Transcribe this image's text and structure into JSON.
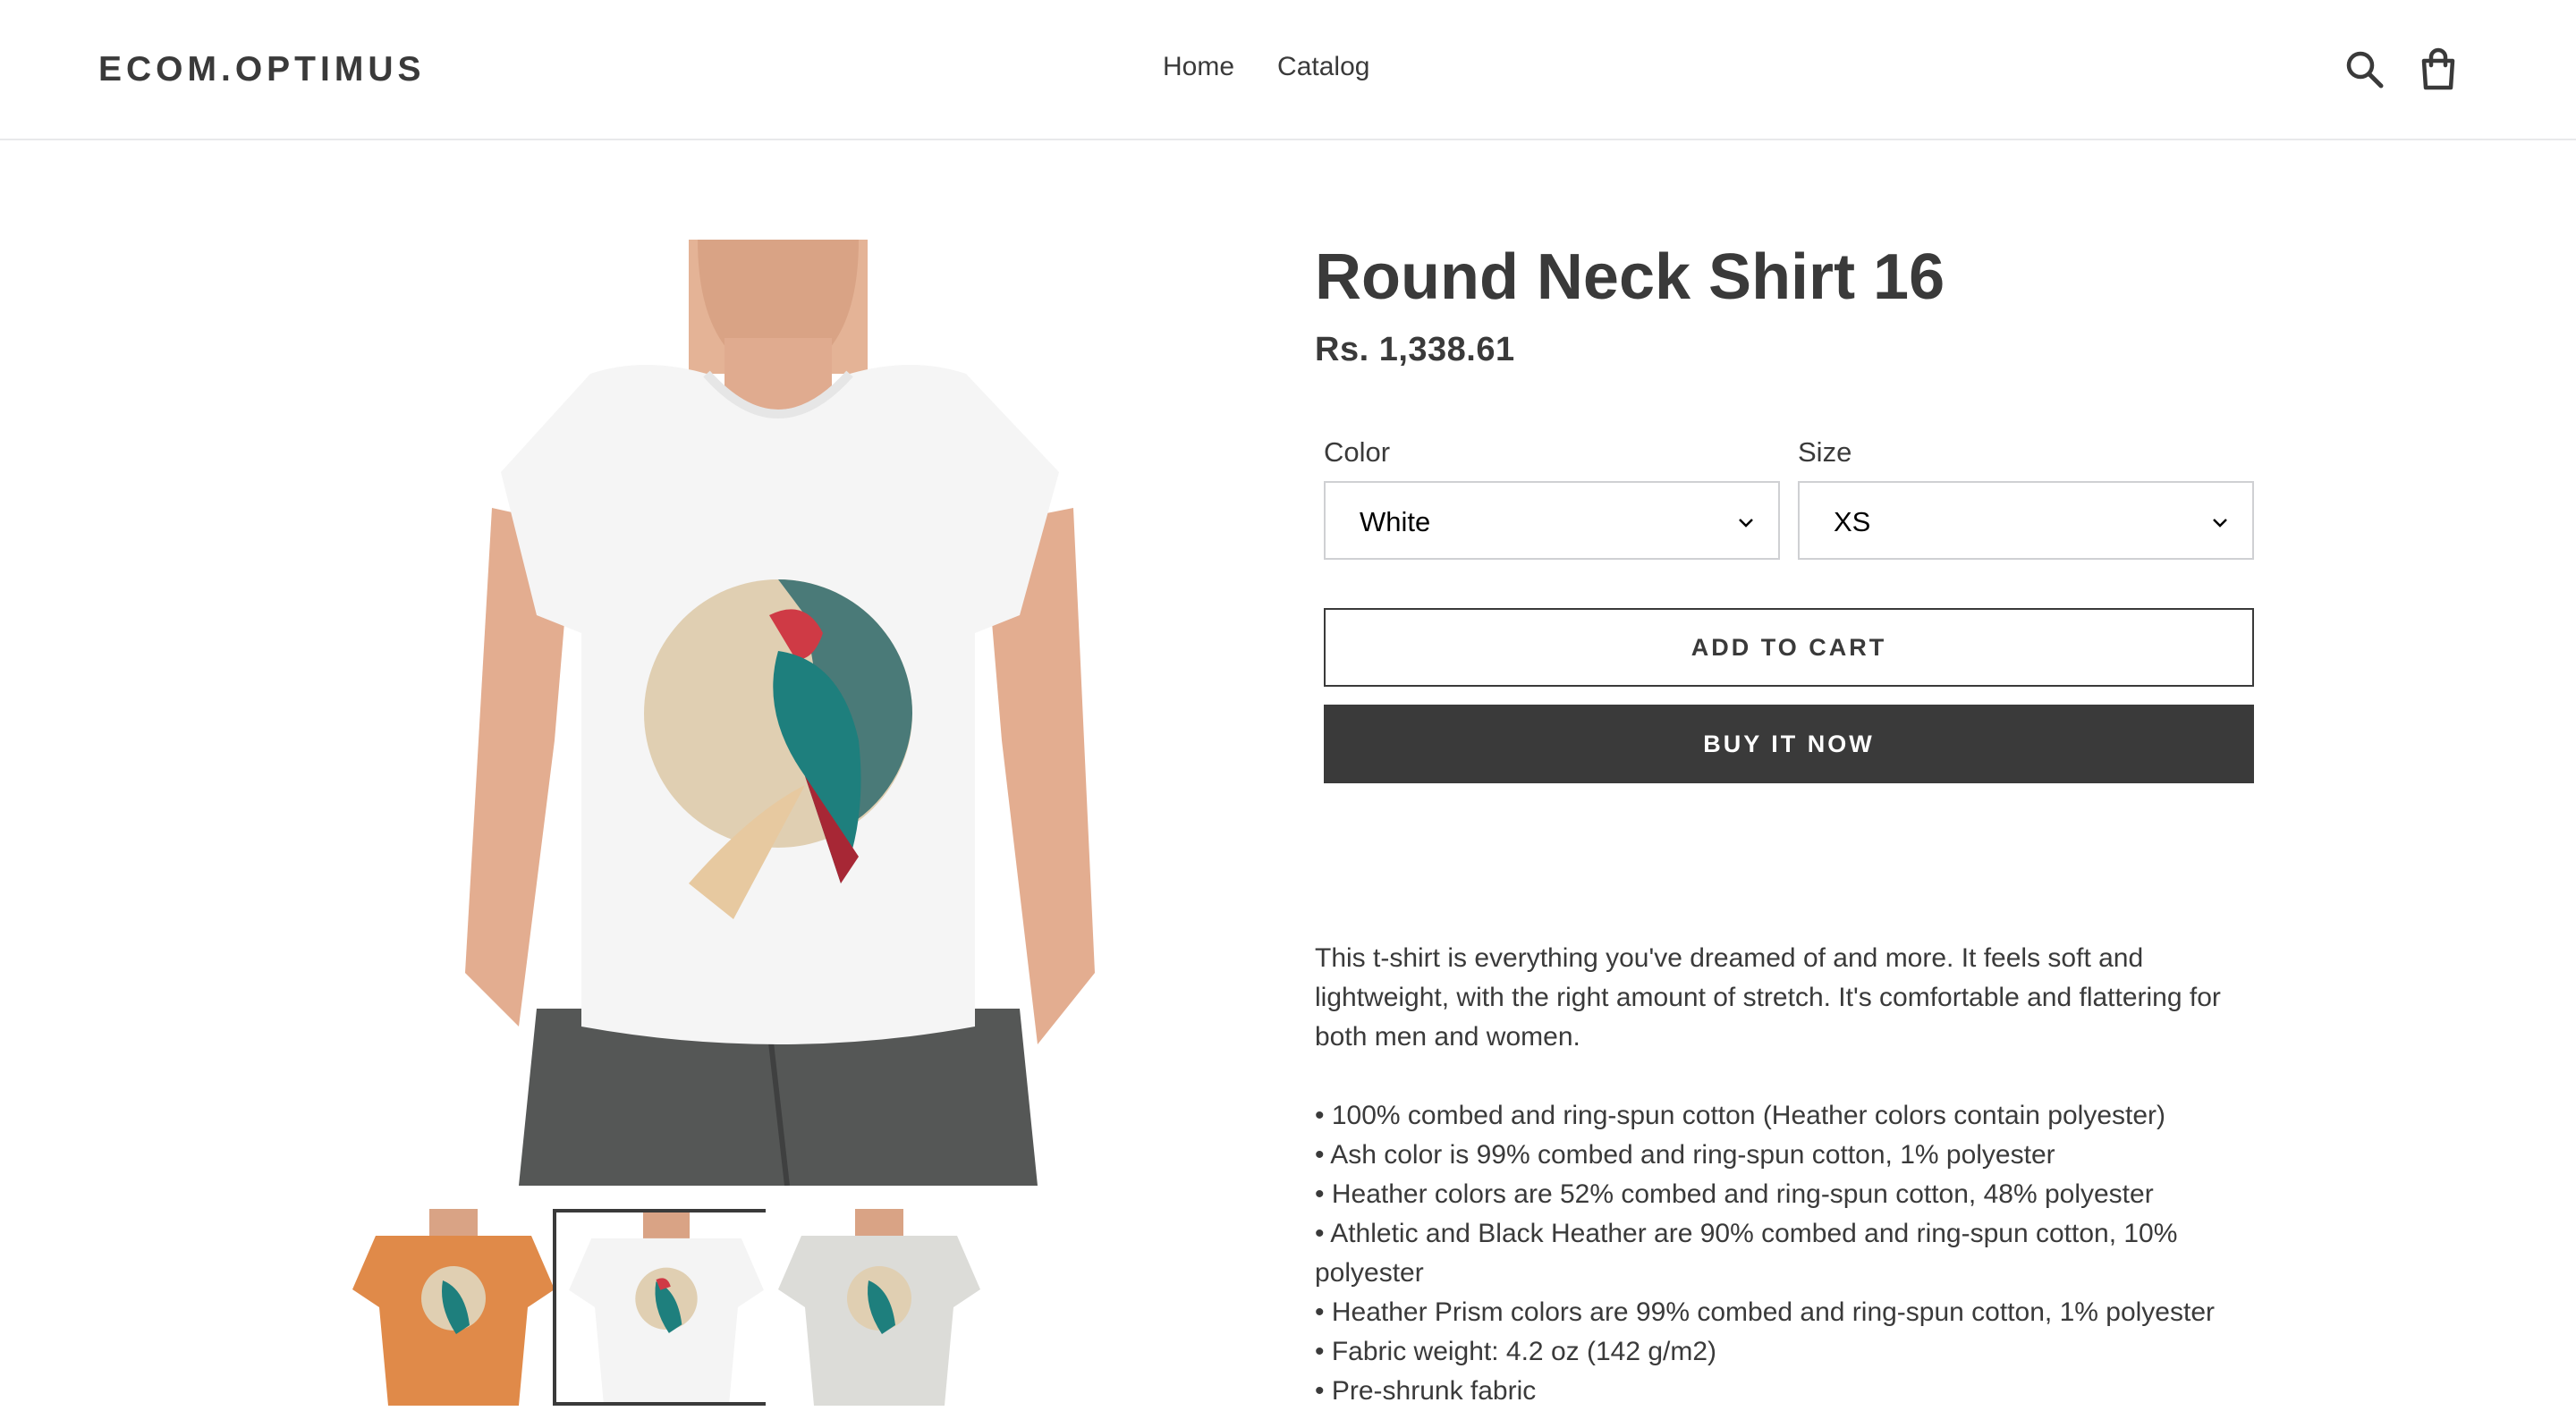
{
  "header": {
    "logo": "ECOM.OPTIMUS",
    "nav": [
      {
        "label": "Home"
      },
      {
        "label": "Catalog"
      }
    ],
    "search_icon": "search-icon",
    "cart_icon": "cart-icon"
  },
  "gallery": {
    "thumbnails": [
      {
        "color": "Orange",
        "shirt_color": "#e08a49"
      },
      {
        "color": "White",
        "shirt_color": "#f4f4f4",
        "active": true
      },
      {
        "color": "Ash",
        "shirt_color": "#dcdcd8"
      }
    ]
  },
  "product": {
    "title": "Round Neck Shirt 16",
    "price": "Rs. 1,338.61",
    "options": {
      "color": {
        "label": "Color",
        "value": "White"
      },
      "size": {
        "label": "Size",
        "value": "XS"
      }
    },
    "add_to_cart": "ADD TO CART",
    "buy_now": "BUY IT NOW",
    "description": {
      "intro": "This t-shirt is everything you've dreamed of and more. It feels soft and lightweight, with the right amount of stretch. It's comfortable and flattering for both men and women.",
      "bullets": [
        "100% combed and ring-spun cotton (Heather colors contain polyester)",
        "Ash color is 99% combed and ring-spun cotton, 1% polyester",
        "Heather colors are 52% combed and ring-spun cotton, 48% polyester",
        "Athletic and Black Heather are 90% combed and ring-spun cotton, 10% polyester",
        "Heather Prism colors are 99% combed and ring-spun cotton, 1% polyester",
        "Fabric weight: 4.2 oz (142 g/m2)",
        "Pre-shrunk fabric"
      ]
    }
  },
  "colors": {
    "text": "#3a3a3a",
    "border": "#cfd0d3",
    "button_dark": "#3a3a3a"
  }
}
